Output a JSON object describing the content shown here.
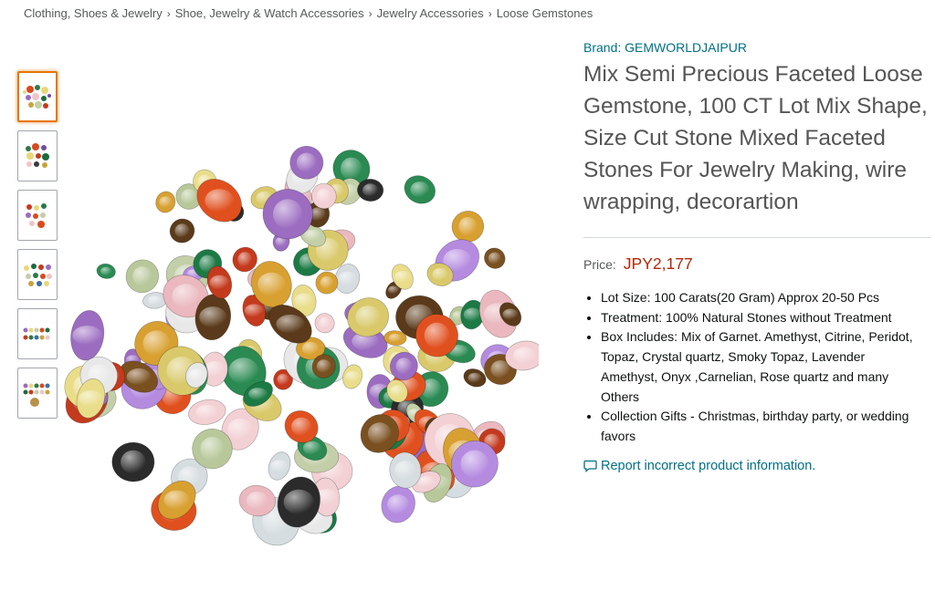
{
  "breadcrumb": {
    "items": [
      "Clothing, Shoes & Jewelry",
      "Shoe, Jewelry & Watch Accessories",
      "Jewelry Accessories",
      "Loose Gemstones"
    ],
    "separator": "›"
  },
  "thumbnails": {
    "count": 6,
    "selected_index": 0
  },
  "product": {
    "brand": "Brand: GEMWORLDJAIPUR",
    "title": "Mix Semi Precious Faceted Loose Gemstone, 100 CT Lot Mix Shape, Size Cut Stone Mixed Faceted Stones For Jewelry Making, wire wrapping, decorartion",
    "price_label": "Price:",
    "price_value": "JPY2,177",
    "bullets": [
      "Lot Size: 100 Carats(20 Gram) Approx 20-50 Pcs",
      "Treatment: 100% Natural Stones without Treatment",
      "Box Includes: Mix of Garnet. Amethyst, Citrine, Peridot, Topaz, Crystal quartz, Smoky Topaz, Lavender Amethyst, Onyx ,Carnelian, Rose quartz and many Others",
      "Collection Gifts - Christmas, birthday party, or wedding favors"
    ],
    "report_link": "Report incorrect product information."
  },
  "colors": {
    "link": "#007185",
    "price": "#b12704",
    "selected_thumb_border": "#e77600",
    "title": "#555555"
  },
  "icons": {
    "breadcrumb_separator": "chevron-right-icon",
    "report": "speech-bubble-icon"
  }
}
